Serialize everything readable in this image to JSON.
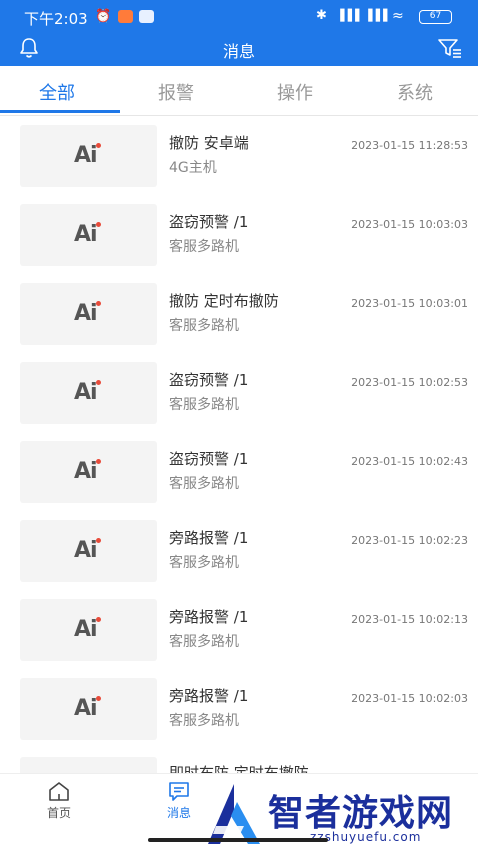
{
  "status_bar": {
    "time": "下午2:03",
    "signal1": "▐▐▐",
    "signal2": "▐▐▐",
    "battery": "67"
  },
  "header": {
    "title": "消息"
  },
  "tabs": [
    {
      "label": "全部",
      "active": true
    },
    {
      "label": "报警",
      "active": false
    },
    {
      "label": "操作",
      "active": false
    },
    {
      "label": "系统",
      "active": false
    }
  ],
  "thumbnail_text": "Ai",
  "messages": [
    {
      "title": "撤防  安卓端",
      "subtitle": "4G主机",
      "time": "2023-01-15 11:28:53"
    },
    {
      "title": "盗窃预警  /1",
      "subtitle": "客服多路机",
      "time": "2023-01-15 10:03:03"
    },
    {
      "title": "撤防  定时布撤防",
      "subtitle": "客服多路机",
      "time": "2023-01-15 10:03:01"
    },
    {
      "title": "盗窃预警  /1",
      "subtitle": "客服多路机",
      "time": "2023-01-15 10:02:53"
    },
    {
      "title": "盗窃预警  /1",
      "subtitle": "客服多路机",
      "time": "2023-01-15 10:02:43"
    },
    {
      "title": "旁路报警  /1",
      "subtitle": "客服多路机",
      "time": "2023-01-15 10:02:23"
    },
    {
      "title": "旁路报警  /1",
      "subtitle": "客服多路机",
      "time": "2023-01-15 10:02:13"
    },
    {
      "title": "旁路报警  /1",
      "subtitle": "客服多路机",
      "time": "2023-01-15 10:02:03"
    },
    {
      "title": "即时布防  定时布撤防",
      "subtitle": "",
      "time": ""
    }
  ],
  "bottom_nav": [
    {
      "label": "首页",
      "active": false
    },
    {
      "label": "消息",
      "active": true
    }
  ],
  "watermark": {
    "text": "智者游戏网",
    "url": "zzshuyuefu.com"
  },
  "colors": {
    "accent": "#1f78e8",
    "watermark": "#1b2f9c"
  }
}
